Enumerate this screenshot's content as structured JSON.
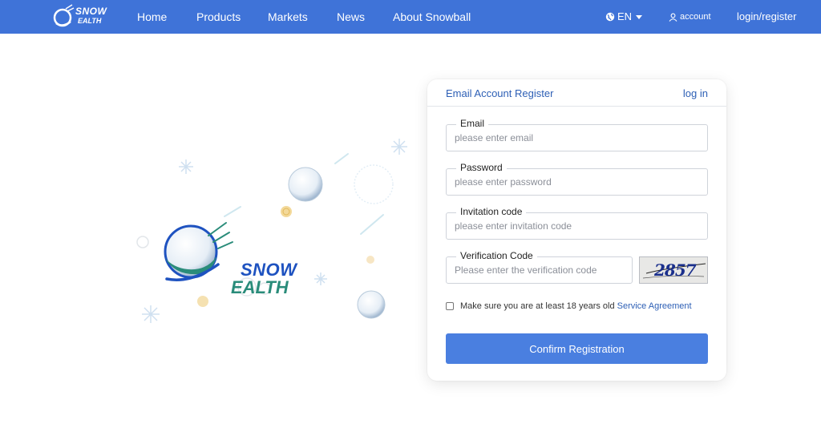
{
  "header": {
    "logo_line1": "SNOW",
    "logo_line2": "EALTH",
    "nav": [
      "Home",
      "Products",
      "Markets",
      "News",
      "About Snowball"
    ],
    "language": "EN",
    "account": "account",
    "login_register": "login/register"
  },
  "illustration": {
    "brand_line1": "SNOW",
    "brand_line2": "EALTH"
  },
  "card": {
    "title": "Email Account Register",
    "login_link": "log in",
    "fields": {
      "email": {
        "label": "Email",
        "placeholder": "please enter email",
        "value": ""
      },
      "password": {
        "label": "Password",
        "placeholder": "please enter password",
        "value": ""
      },
      "invitation": {
        "label": "Invitation code",
        "placeholder": "please enter invitation code",
        "value": ""
      },
      "verification": {
        "label": "Verification Code",
        "placeholder": "Please enter the verification code",
        "value": ""
      }
    },
    "captcha_text": "2857",
    "agreement_text": "Make sure you are at least 18 years old",
    "agreement_link": "Service Agreement",
    "confirm_label": "Confirm Registration"
  },
  "colors": {
    "nav_background": "#3f73d8",
    "primary_button": "#4a7fe0",
    "link": "#2d5fb5",
    "brand_blue": "#1e52c0",
    "brand_green": "#2a8c7a"
  },
  "icons": {
    "language": "globe-icon",
    "language_dropdown": "caret-down-icon",
    "account": "user-icon"
  }
}
